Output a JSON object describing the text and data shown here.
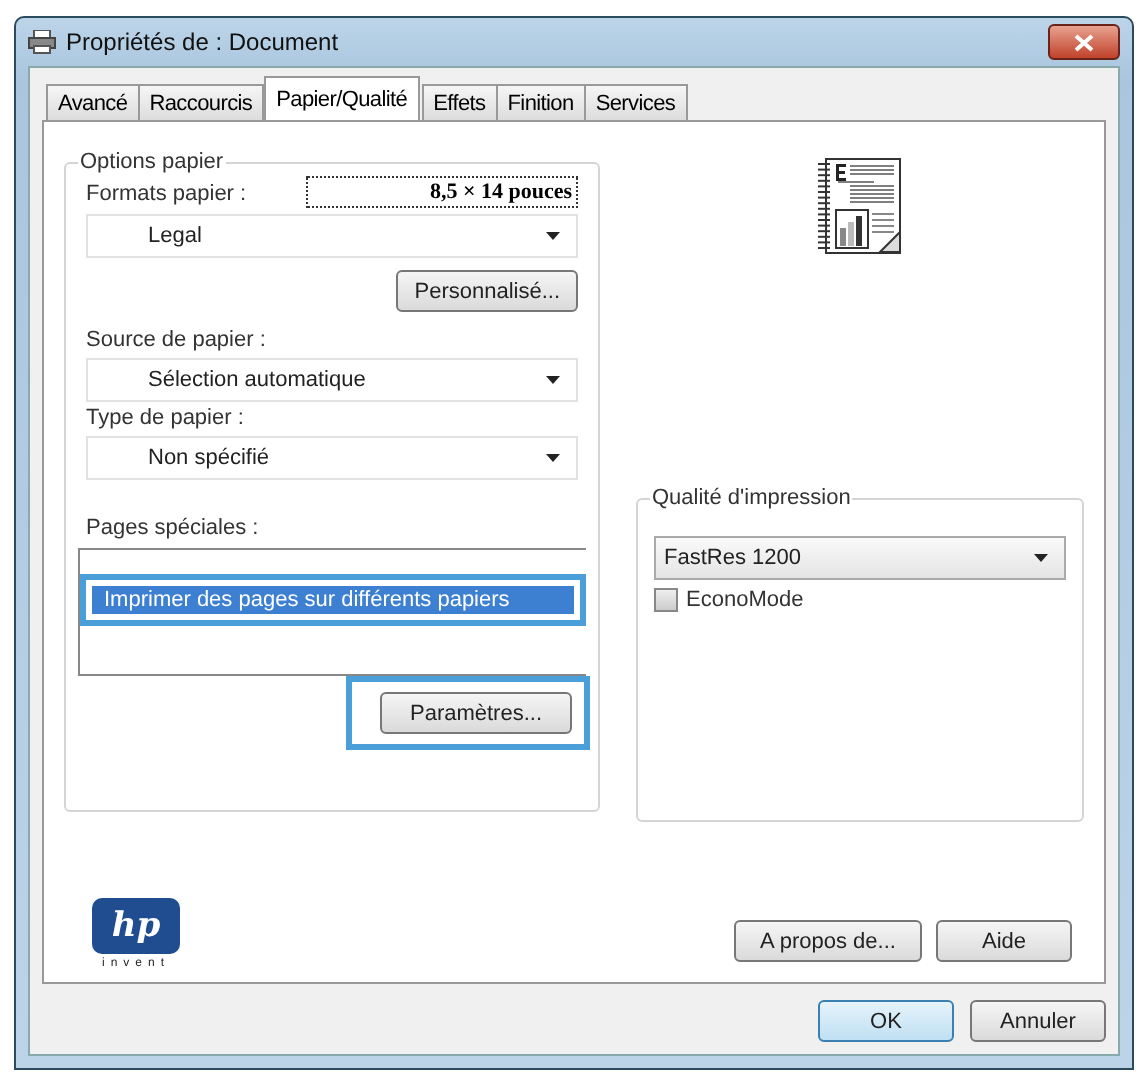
{
  "window": {
    "title": "Propriétés de : Document"
  },
  "tabs": [
    {
      "label": "Avancé",
      "selected": false
    },
    {
      "label": "Raccourcis",
      "selected": false
    },
    {
      "label": "Papier/Qualité",
      "selected": true
    },
    {
      "label": "Effets",
      "selected": false
    },
    {
      "label": "Finition",
      "selected": false
    },
    {
      "label": "Services",
      "selected": false
    }
  ],
  "paper_options": {
    "title": "Options papier",
    "formats_label": "Formats papier :",
    "format_size": "8,5 × 14 pouces",
    "format_value": "Legal",
    "custom_button": "Personnalisé...",
    "source_label": "Source de papier :",
    "source_value": "Sélection automatique",
    "type_label": "Type de papier :",
    "type_value": "Non spécifié"
  },
  "special_pages": {
    "label": "Pages spéciales :",
    "items": [
      {
        "label": "Imprimer des pages sur différents papiers",
        "selected": true,
        "highlighted": true
      }
    ],
    "settings_button": "Paramètres...",
    "settings_highlighted": true
  },
  "print_quality": {
    "title": "Qualité d'impression",
    "value": "FastRes 1200",
    "econo_mode": {
      "label": "EconoMode",
      "checked": false
    }
  },
  "logo": {
    "mark": "hp",
    "tagline": "invent"
  },
  "panel_buttons": [
    "A propos de...",
    "Aide"
  ],
  "dialog_buttons": [
    {
      "label": "OK",
      "default": true
    },
    {
      "label": "Annuler",
      "default": false
    }
  ]
}
